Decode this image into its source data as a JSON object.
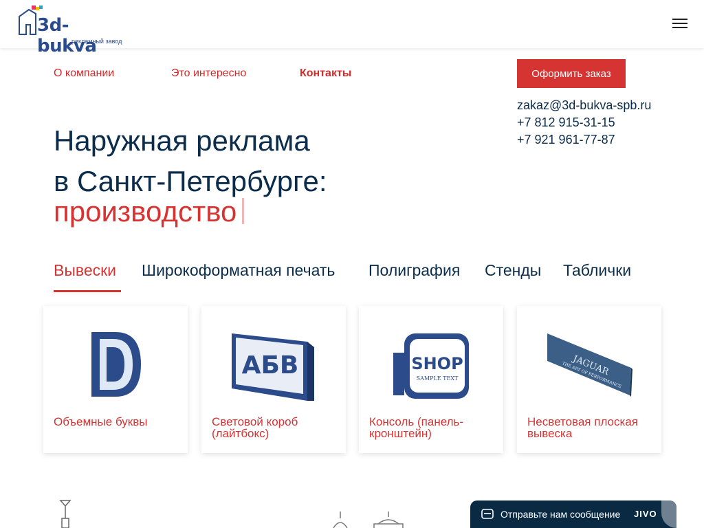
{
  "header": {
    "logo_text": "3d-bukva",
    "logo_sub": "рекламный завод"
  },
  "nav": {
    "items": [
      "О компании",
      "Это интересно",
      "Контакты"
    ],
    "active": "Контакты"
  },
  "order_button": "Оформить заказ",
  "contacts": {
    "email": "zakaz@3d-bukva-spb.ru",
    "phone1": "+7 812 915-31-15",
    "phone2": "+7 921 961-77-87"
  },
  "hero": {
    "line1": "Наружная реклама",
    "line2": "в Санкт-Петербурге:",
    "accent": "производство"
  },
  "tabs": [
    "Вывески",
    "Широкоформатная печать",
    "Полиграфия",
    "Стенды",
    "Таблички"
  ],
  "active_tab": "Вывески",
  "cards": [
    {
      "title": "Объемные буквы",
      "image": "letter-D"
    },
    {
      "title": "Световой короб (лайтбокс)",
      "image": "lightbox-ABV"
    },
    {
      "title": "Консоль (панель-кронштейн)",
      "image": "shop-console"
    },
    {
      "title": "Несветовая плоская вывеска",
      "image": "jaguar-plate"
    }
  ],
  "card_image_text": {
    "lightbox": "АБВ",
    "shop": "SHOP",
    "shop_sub": "SAMPLE TEXT",
    "jaguar": "JAGUAR",
    "jaguar_sub": "THE ART OF PERFORMANCE"
  },
  "chat": {
    "label": "Отправьте нам сообщение",
    "brand": "JIVO"
  },
  "colors": {
    "accent": "#d63333",
    "navy": "#0b2d4b",
    "chat_bg": "#0a2a44"
  }
}
